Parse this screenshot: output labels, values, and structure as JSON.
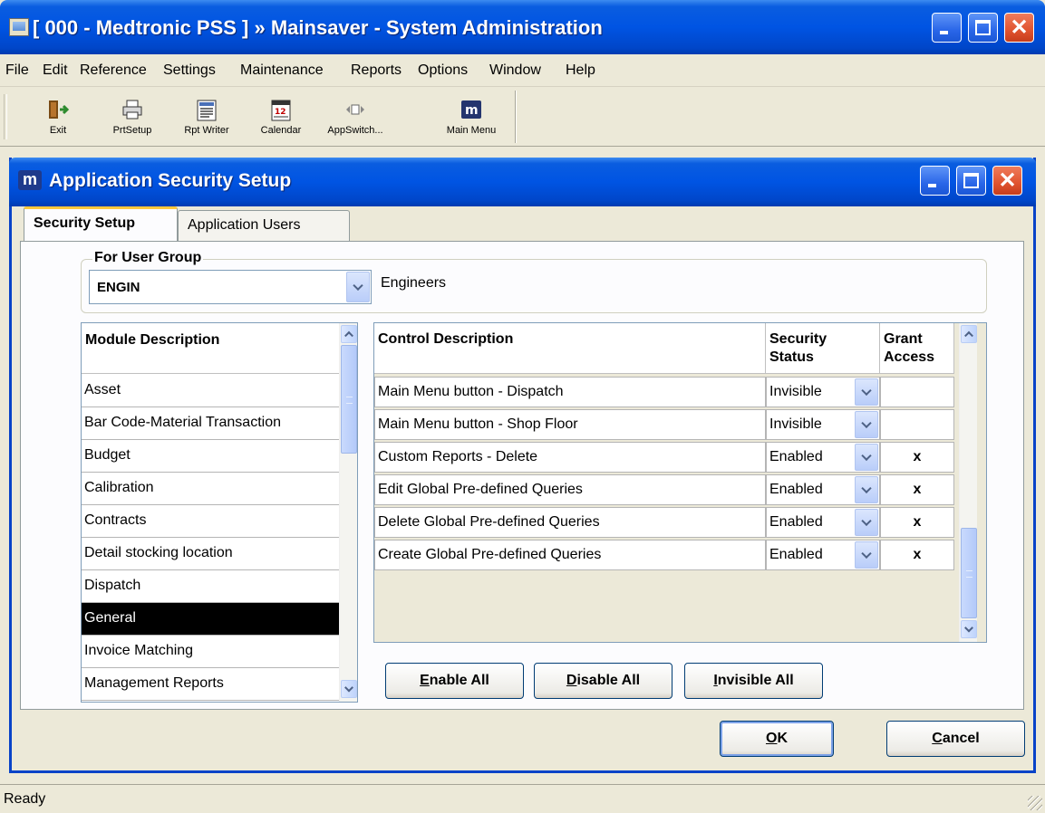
{
  "window": {
    "title": "[ 000 - Medtronic PSS ] » Mainsaver - System Administration",
    "minimize": "_",
    "close": "✕"
  },
  "menu": [
    "File",
    "Edit",
    "Reference",
    "Settings",
    "Maintenance",
    "Reports",
    "Options",
    "Window",
    "Help"
  ],
  "toolbar": {
    "items": [
      {
        "label": "Exit",
        "icon": "exit-door-icon"
      },
      {
        "label": "PrtSetup",
        "icon": "printer-icon"
      },
      {
        "label": "Rpt Writer",
        "icon": "report-writer-icon"
      },
      {
        "label": "Calendar",
        "icon": "calendar-icon"
      },
      {
        "label": "AppSwitch...",
        "icon": "app-switch-icon"
      },
      {
        "label": "Main Menu",
        "icon": "mainsaver-logo-icon"
      }
    ]
  },
  "child": {
    "icon_letter": "m",
    "title": "Application Security Setup"
  },
  "tabs": [
    {
      "label": "Security Setup",
      "active": true
    },
    {
      "label": "Application Users",
      "active": false
    }
  ],
  "user_group": {
    "legend": "For User Group",
    "value": "ENGIN",
    "description": "Engineers"
  },
  "modules": {
    "header": "Module Description",
    "items": [
      "Asset",
      "Bar Code-Material Transaction",
      "Budget",
      "Calibration",
      "Contracts",
      "Detail stocking location",
      "Dispatch",
      "General",
      "Invoice Matching",
      "Management Reports"
    ],
    "selected": "General"
  },
  "controls": {
    "headers": {
      "description": "Control Description",
      "status_line1": "Security",
      "status_line2": "Status",
      "grant_line1": "Grant",
      "grant_line2": "Access"
    },
    "rows": [
      {
        "description": "Main Menu button - Dispatch",
        "status": "Invisible",
        "grant": ""
      },
      {
        "description": "Main Menu button - Shop Floor",
        "status": "Invisible",
        "grant": ""
      },
      {
        "description": "Custom Reports - Delete",
        "status": "Enabled",
        "grant": "x"
      },
      {
        "description": "Edit Global Pre-defined Queries",
        "status": "Enabled",
        "grant": "x"
      },
      {
        "description": "Delete Global Pre-defined Queries",
        "status": "Enabled",
        "grant": "x"
      },
      {
        "description": "Create Global Pre-defined Queries",
        "status": "Enabled",
        "grant": "x"
      }
    ]
  },
  "actions": {
    "enable_all": {
      "mnemonic": "E",
      "rest": "nable All"
    },
    "disable_all": {
      "mnemonic": "D",
      "rest": "isable All"
    },
    "invisible_all": {
      "mnemonic": "I",
      "rest": "nvisible All"
    },
    "ok": {
      "mnemonic": "O",
      "rest": "K"
    },
    "cancel": {
      "mnemonic": "C",
      "rest": "ancel"
    }
  },
  "status": "Ready",
  "colors": {
    "title_blue": "#0054e3",
    "selection": "#000000",
    "close_red": "#e0532f"
  }
}
